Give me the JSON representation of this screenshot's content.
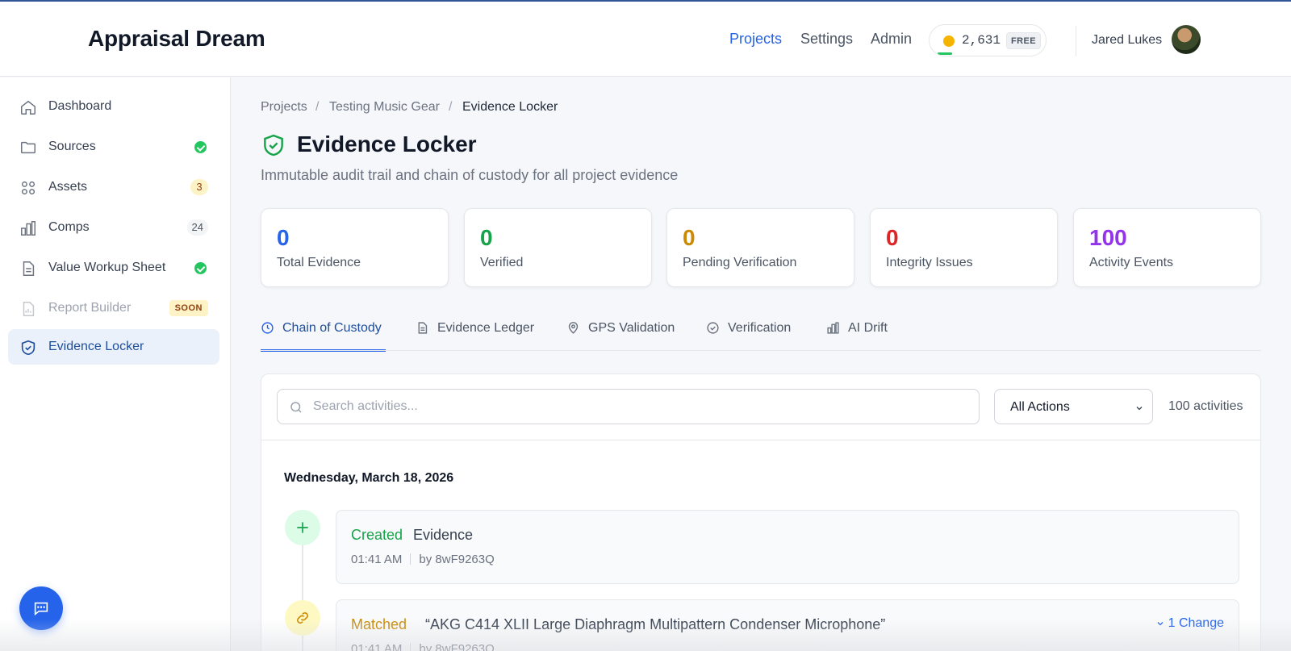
{
  "app": {
    "brand": "Appraisal Dream",
    "nav": [
      "Projects",
      "Settings",
      "Admin"
    ],
    "active_nav": "Projects",
    "credits": "2,631",
    "plan": "FREE",
    "user_name": "Jared Lukes",
    "colors": {
      "accent": "#2563eb",
      "success": "#22c55e",
      "warning": "#f4b400"
    }
  },
  "sidebar": {
    "items": [
      {
        "label": "Dashboard",
        "icon": "home-icon"
      },
      {
        "label": "Sources",
        "icon": "folder-icon",
        "status": "complete"
      },
      {
        "label": "Assets",
        "icon": "grid-icon",
        "count": "3"
      },
      {
        "label": "Comps",
        "icon": "bar-chart-icon",
        "count": "24"
      },
      {
        "label": "Value Workup Sheet",
        "icon": "document-icon",
        "status": "complete"
      },
      {
        "label": "Report Builder",
        "icon": "report-icon",
        "badge": "SOON"
      },
      {
        "label": "Evidence Locker",
        "icon": "shield-check-icon",
        "active": true
      }
    ]
  },
  "breadcrumb": [
    "Projects",
    "Testing Music Gear",
    "Evidence Locker"
  ],
  "page": {
    "title": "Evidence Locker",
    "subtitle": "Immutable audit trail and chain of custody for all project evidence"
  },
  "stats": [
    {
      "value": "0",
      "label": "Total Evidence",
      "color": "#2563eb"
    },
    {
      "value": "0",
      "label": "Verified",
      "color": "#16a34a"
    },
    {
      "value": "0",
      "label": "Pending Verification",
      "color": "#ca8a04"
    },
    {
      "value": "0",
      "label": "Integrity Issues",
      "color": "#dc2626"
    },
    {
      "value": "100",
      "label": "Activity Events",
      "color": "#9333ea"
    }
  ],
  "tabs": [
    {
      "label": "Chain of Custody",
      "icon": "clock-icon",
      "active": true
    },
    {
      "label": "Evidence Ledger",
      "icon": "document-icon"
    },
    {
      "label": "GPS Validation",
      "icon": "map-pin-icon"
    },
    {
      "label": "Verification",
      "icon": "check-circle-icon"
    },
    {
      "label": "AI Drift",
      "icon": "bar-chart-icon"
    }
  ],
  "activity": {
    "search_placeholder": "Search activities...",
    "filter_value": "All Actions",
    "count_label": "100 activities",
    "day": "Wednesday, March 18, 2026",
    "events": [
      {
        "verb": "Created",
        "target": "Evidence",
        "time": "01:41 AM",
        "by": "by 8wF9263Q",
        "icon": "plus-icon"
      },
      {
        "verb": "Matched",
        "target": "“AKG C414 XLII Large Diaphragm Multipattern Condenser Microphone”",
        "time": "01:41 AM",
        "by": "by 8wF9263Q",
        "icon": "link-icon",
        "changes": "1 Change"
      }
    ]
  }
}
